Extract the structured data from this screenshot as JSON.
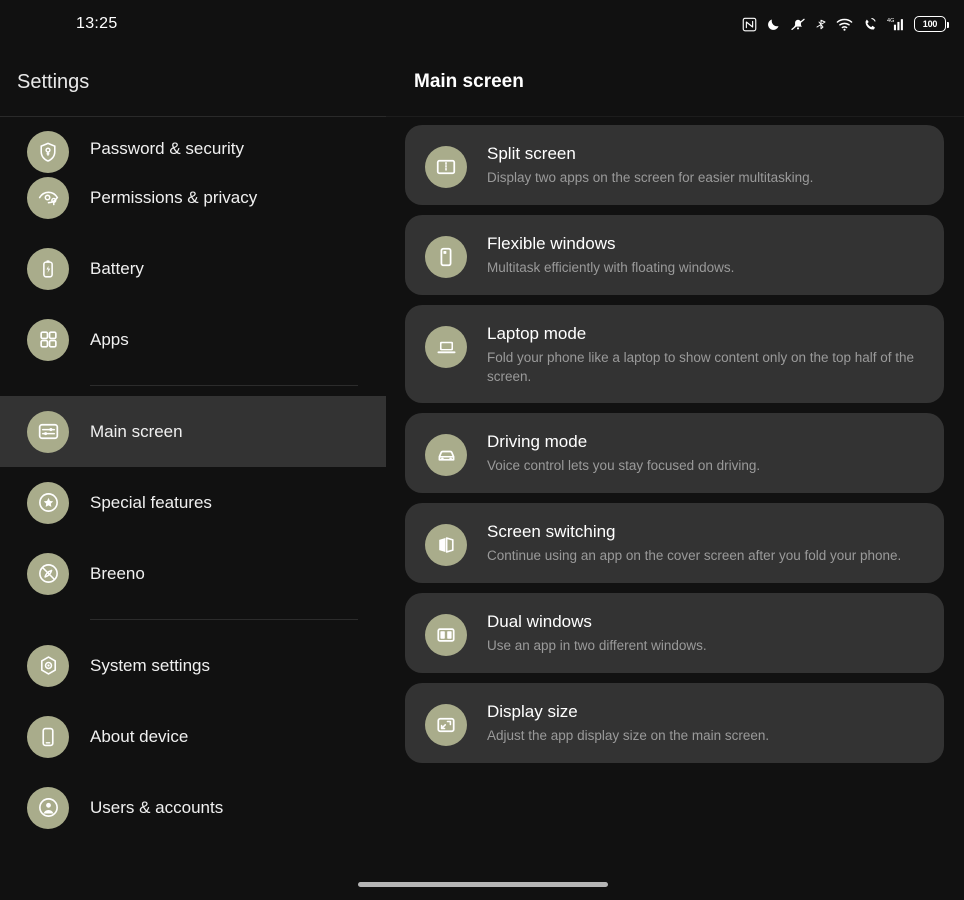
{
  "status_bar": {
    "clock": "13:25",
    "battery_level": "100",
    "icons": [
      "nfc-icon",
      "do-not-disturb-moon-icon",
      "notifications-muted-icon",
      "bluetooth-icon",
      "wifi-icon",
      "volte-call-icon",
      "cellular-signal-4g-icon",
      "battery-icon"
    ]
  },
  "sidebar": {
    "title": "Settings",
    "items": [
      {
        "label": "Password & security",
        "icon": "shield-key-icon",
        "selected": false,
        "clipped": true
      },
      {
        "label": "Permissions & privacy",
        "icon": "eye-privacy-icon",
        "selected": false
      },
      {
        "label": "Battery",
        "icon": "battery-icon",
        "selected": false
      },
      {
        "label": "Apps",
        "icon": "apps-grid-icon",
        "selected": false
      },
      {
        "label": "Main screen",
        "icon": "sliders-screen-icon",
        "selected": true
      },
      {
        "label": "Special features",
        "icon": "star-badge-icon",
        "selected": false
      },
      {
        "label": "Breeno",
        "icon": "breeno-assistant-icon",
        "selected": false
      },
      {
        "label": "System settings",
        "icon": "gear-hexagon-icon",
        "selected": false
      },
      {
        "label": "About device",
        "icon": "phone-device-icon",
        "selected": false
      },
      {
        "label": "Users & accounts",
        "icon": "user-account-icon",
        "selected": false
      }
    ],
    "divider_after_indices": [
      3,
      6
    ]
  },
  "main": {
    "title": "Main screen",
    "cards": [
      {
        "title": "Split screen",
        "desc": "Display two apps on the screen for easier multitasking.",
        "icon": "split-screen-icon"
      },
      {
        "title": "Flexible windows",
        "desc": "Multitask efficiently with floating windows.",
        "icon": "flexible-window-icon"
      },
      {
        "title": "Laptop mode",
        "desc": "Fold your phone like a laptop to show content only on the top half of the screen.",
        "icon": "laptop-icon"
      },
      {
        "title": "Driving mode",
        "desc": "Voice control lets you stay focused on driving.",
        "icon": "car-icon"
      },
      {
        "title": "Screen switching",
        "desc": "Continue using an app on the cover screen after you fold your phone.",
        "icon": "open-book-fold-icon"
      },
      {
        "title": "Dual windows",
        "desc": "Use an app in two different windows.",
        "icon": "dual-windows-icon"
      },
      {
        "title": "Display size",
        "desc": "Adjust the app display size on the main screen.",
        "icon": "display-size-icon"
      }
    ]
  },
  "colors": {
    "background": "#111111",
    "card": "#333333",
    "accent": "#a9ac8b",
    "selected_row": "#333333",
    "primary_text": "#ffffff",
    "secondary_text": "#9a9a9a"
  }
}
